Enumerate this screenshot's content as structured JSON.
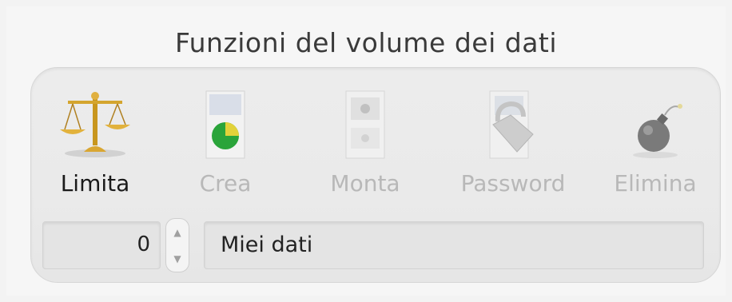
{
  "panel": {
    "title": "Funzioni del volume dei dati"
  },
  "toolbar": [
    {
      "label": "Limita",
      "icon": "scales-icon",
      "enabled": true
    },
    {
      "label": "Crea",
      "icon": "create-volume-icon",
      "enabled": false
    },
    {
      "label": "Monta",
      "icon": "mount-volume-icon",
      "enabled": false
    },
    {
      "label": "Password",
      "icon": "lock-icon",
      "enabled": false
    },
    {
      "label": "Elimina",
      "icon": "bomb-icon",
      "enabled": false
    }
  ],
  "size": {
    "value": "0"
  },
  "volume_name": {
    "value": "Miei dati"
  },
  "colors": {
    "accent_green": "#2aa43a",
    "chart_yellow": "#e2d23a",
    "disabled_text": "#b8b8b8"
  }
}
